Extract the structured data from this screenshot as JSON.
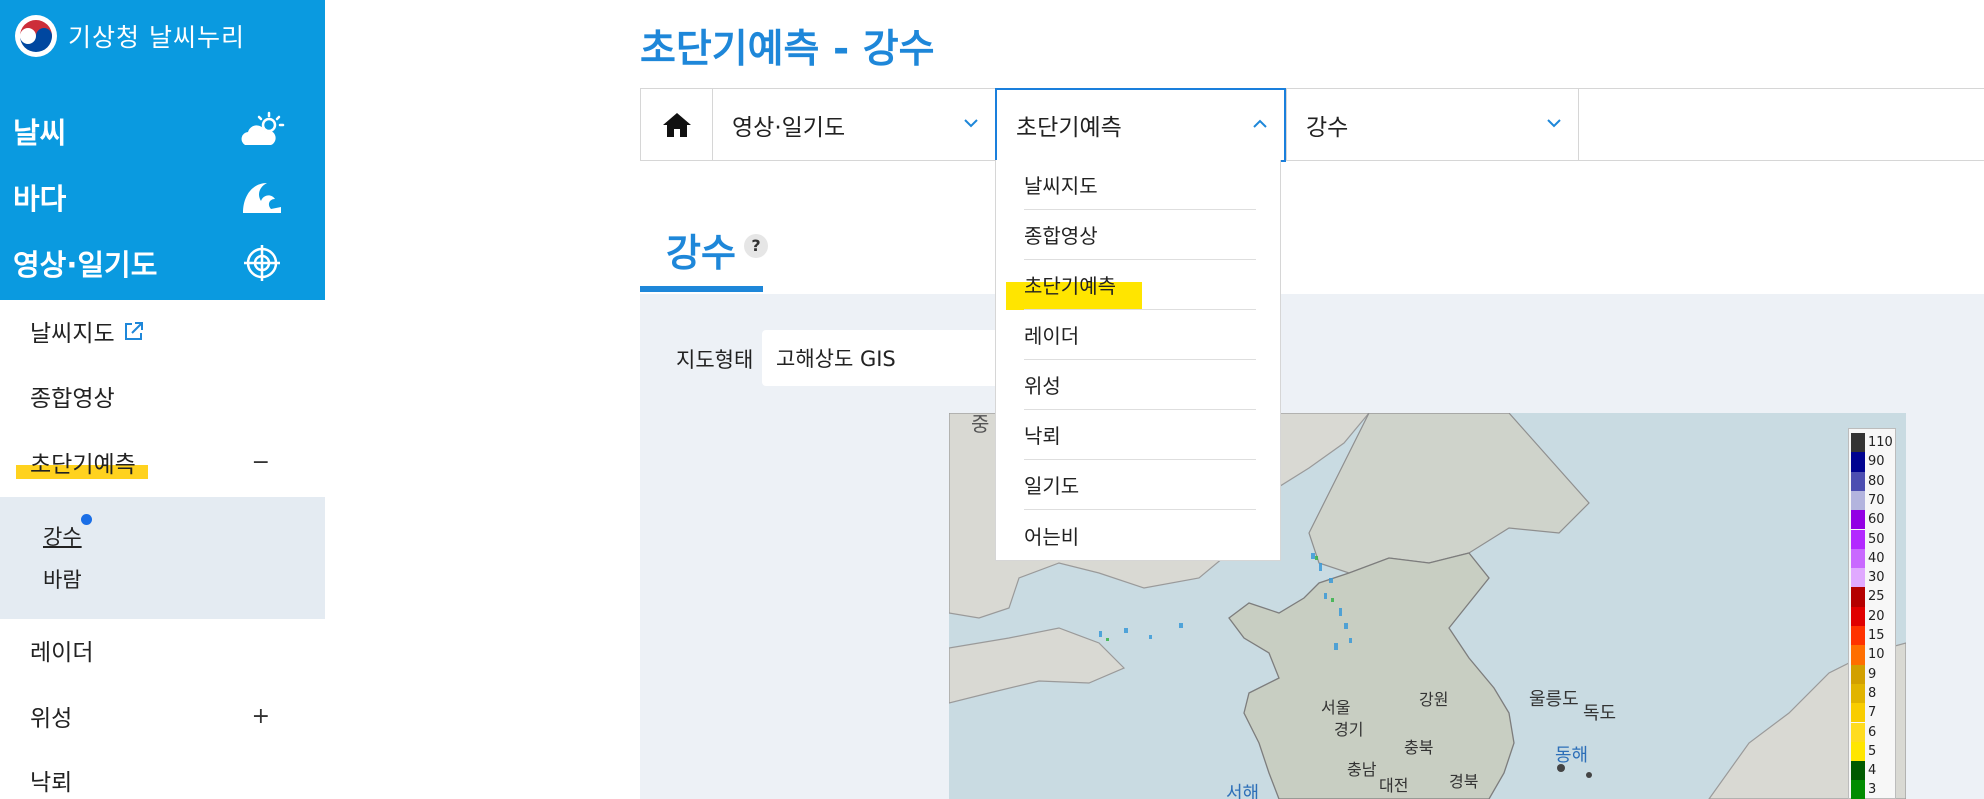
{
  "site": {
    "name": "기상청 날씨누리"
  },
  "sidebar": {
    "categories": [
      {
        "label": "날씨",
        "icon": "cloud-sun-icon"
      },
      {
        "label": "바다",
        "icon": "wave-icon"
      },
      {
        "label": "영상·일기도",
        "icon": "satellite-target-icon"
      }
    ],
    "items": [
      {
        "label": "날씨지도",
        "external": true
      },
      {
        "label": "종합영상"
      },
      {
        "label": "초단기예측",
        "toggle": "−",
        "expanded": true
      },
      {
        "label": "레이더"
      },
      {
        "label": "위성",
        "toggle": "+"
      },
      {
        "label": "낙뢰"
      }
    ],
    "subitems": [
      {
        "label": "강수",
        "active": true
      },
      {
        "label": "바람"
      }
    ]
  },
  "page": {
    "title": "초단기예측 - 강수"
  },
  "nav": {
    "cell1": "영상·일기도",
    "cell2": "초단기예측",
    "cell3": "강수"
  },
  "dropdown": {
    "items": [
      "날씨지도",
      "종합영상",
      "초단기예측",
      "레이더",
      "위성",
      "낙뢰",
      "일기도",
      "어는비"
    ],
    "highlighted": "초단기예측"
  },
  "section": {
    "title": "강수",
    "help": "?"
  },
  "maptype": {
    "label": "지도형태",
    "value": "고해상도 GIS"
  },
  "map": {
    "labels": [
      "중",
      "서울",
      "경기",
      "강원",
      "충북",
      "충남",
      "대전",
      "경북",
      "울릉도",
      "독도",
      "동해",
      "서해"
    ]
  },
  "legend": [
    {
      "label": "110",
      "color": "#333333"
    },
    {
      "label": "90",
      "color": "#000390"
    },
    {
      "label": "80",
      "color": "#4c4eb1"
    },
    {
      "label": "70",
      "color": "#b3b4de"
    },
    {
      "label": "60",
      "color": "#9300e4"
    },
    {
      "label": "50",
      "color": "#b329ff"
    },
    {
      "label": "40",
      "color": "#c969ff"
    },
    {
      "label": "30",
      "color": "#e0a9ff"
    },
    {
      "label": "25",
      "color": "#b40000"
    },
    {
      "label": "20",
      "color": "#e00000"
    },
    {
      "label": "15",
      "color": "#ff3200"
    },
    {
      "label": "10",
      "color": "#ff6e00"
    },
    {
      "label": "9",
      "color": "#d2a000"
    },
    {
      "label": "8",
      "color": "#e1b400"
    },
    {
      "label": "7",
      "color": "#f9cd00"
    },
    {
      "label": "6",
      "color": "#ffdc1f"
    },
    {
      "label": "5",
      "color": "#ffe600"
    },
    {
      "label": "4",
      "color": "#005a00"
    },
    {
      "label": "3",
      "color": "#008c00"
    }
  ],
  "colors": {
    "brand": "#0a9ae0",
    "title": "#1e87d9",
    "highlight": "#ffe500"
  }
}
